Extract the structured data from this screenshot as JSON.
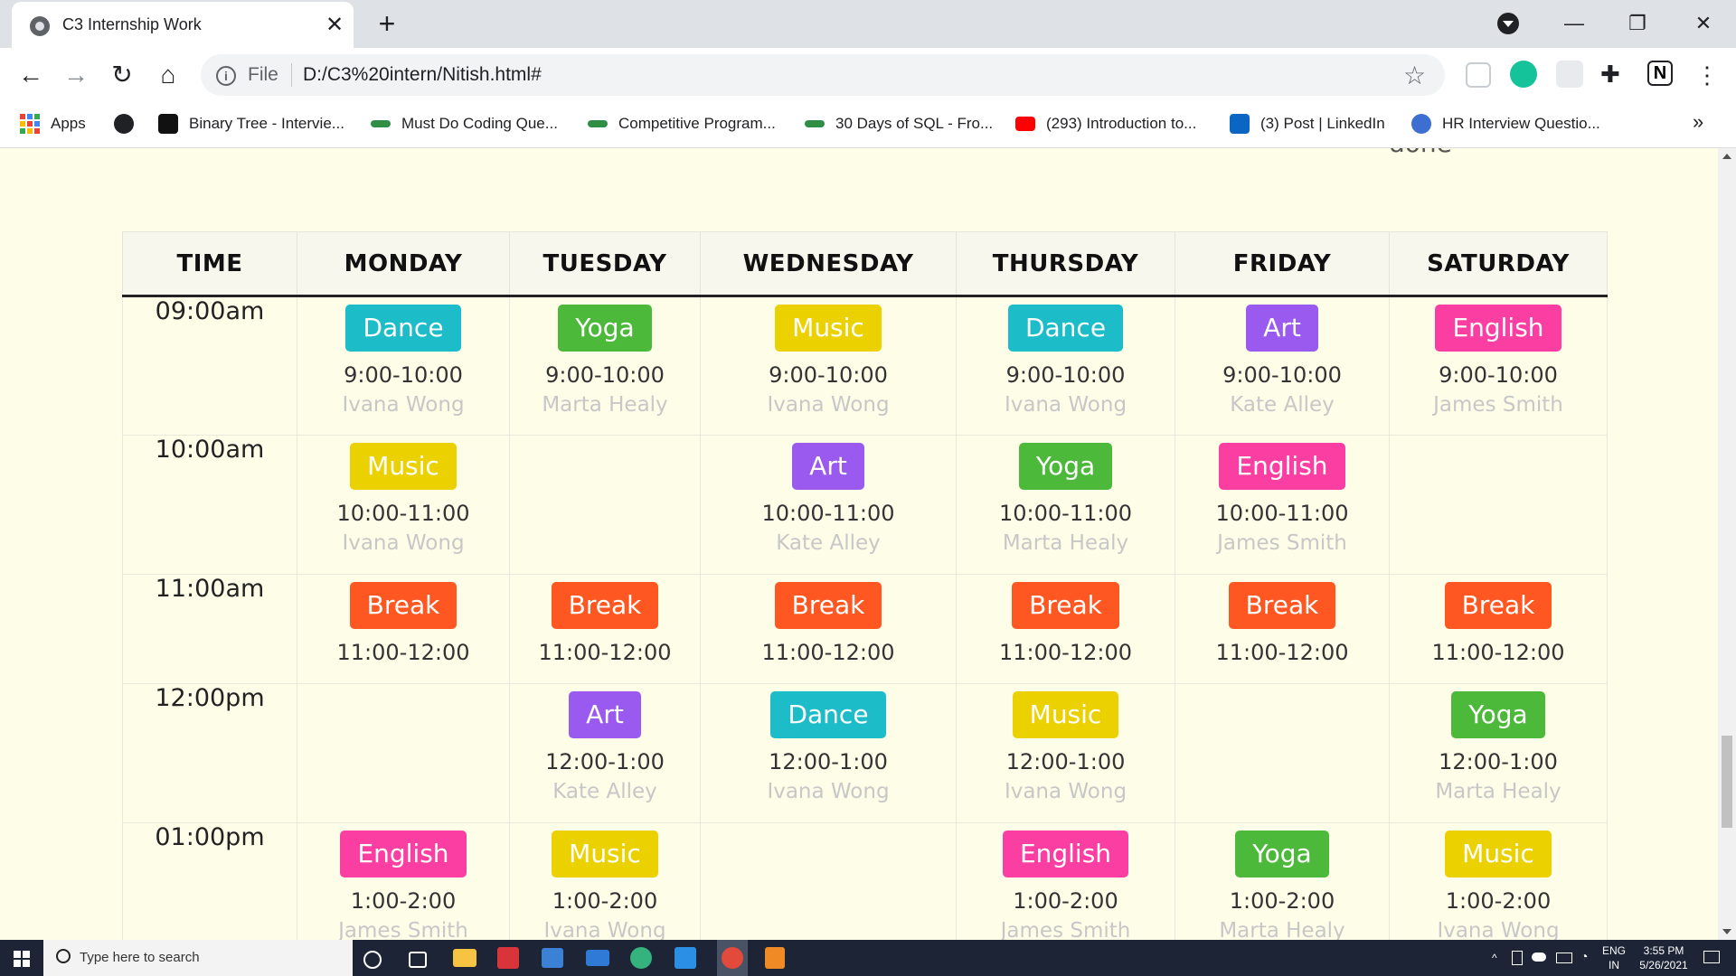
{
  "browser": {
    "tab_title": "C3 Internship Work",
    "tab_close": "✕",
    "new_tab": "+",
    "url_scheme": "File",
    "url": "D:/C3%20intern/Nitish.html#",
    "win_minimize": "—",
    "win_restore": "❐",
    "win_close": "✕"
  },
  "bookmarks": [
    {
      "label": "Apps"
    },
    {
      "label": ""
    },
    {
      "label": "Binary Tree - Intervie..."
    },
    {
      "label": "Must Do Coding Que..."
    },
    {
      "label": "Competitive Program..."
    },
    {
      "label": "30 Days of SQL - Fro..."
    },
    {
      "label": "(293) Introduction to..."
    },
    {
      "label": "(3) Post | LinkedIn"
    },
    {
      "label": "HR Interview Questio..."
    }
  ],
  "bookmarks_more": "»",
  "page": {
    "partial_text": "done",
    "headers": [
      "TIME",
      "MONDAY",
      "TUESDAY",
      "WEDNESDAY",
      "THURSDAY",
      "FRIDAY",
      "SATURDAY"
    ],
    "rows": [
      {
        "time": "09:00am",
        "cells": [
          {
            "subject": "Dance",
            "color": "#1cbcc8",
            "slot": "9:00-10:00",
            "teacher": "Ivana Wong"
          },
          {
            "subject": "Yoga",
            "color": "#4cb93a",
            "slot": "9:00-10:00",
            "teacher": "Marta Healy"
          },
          {
            "subject": "Music",
            "color": "#ecd100",
            "slot": "9:00-10:00",
            "teacher": "Ivana Wong"
          },
          {
            "subject": "Dance",
            "color": "#1cbcc8",
            "slot": "9:00-10:00",
            "teacher": "Ivana Wong"
          },
          {
            "subject": "Art",
            "color": "#9a59ef",
            "slot": "9:00-10:00",
            "teacher": "Kate Alley"
          },
          {
            "subject": "English",
            "color": "#fb3ea2",
            "slot": "9:00-10:00",
            "teacher": "James Smith"
          }
        ]
      },
      {
        "time": "10:00am",
        "cells": [
          {
            "subject": "Music",
            "color": "#ecd100",
            "slot": "10:00-11:00",
            "teacher": "Ivana Wong"
          },
          null,
          {
            "subject": "Art",
            "color": "#9a59ef",
            "slot": "10:00-11:00",
            "teacher": "Kate Alley"
          },
          {
            "subject": "Yoga",
            "color": "#4cb93a",
            "slot": "10:00-11:00",
            "teacher": "Marta Healy"
          },
          {
            "subject": "English",
            "color": "#fb3ea2",
            "slot": "10:00-11:00",
            "teacher": "James Smith"
          },
          null
        ]
      },
      {
        "time": "11:00am",
        "cells": [
          {
            "subject": "Break",
            "color": "#fe5722",
            "slot": "11:00-12:00",
            "teacher": ""
          },
          {
            "subject": "Break",
            "color": "#fe5722",
            "slot": "11:00-12:00",
            "teacher": ""
          },
          {
            "subject": "Break",
            "color": "#fe5722",
            "slot": "11:00-12:00",
            "teacher": ""
          },
          {
            "subject": "Break",
            "color": "#fe5722",
            "slot": "11:00-12:00",
            "teacher": ""
          },
          {
            "subject": "Break",
            "color": "#fe5722",
            "slot": "11:00-12:00",
            "teacher": ""
          },
          {
            "subject": "Break",
            "color": "#fe5722",
            "slot": "11:00-12:00",
            "teacher": ""
          }
        ]
      },
      {
        "time": "12:00pm",
        "cells": [
          null,
          {
            "subject": "Art",
            "color": "#9a59ef",
            "slot": "12:00-1:00",
            "teacher": "Kate Alley"
          },
          {
            "subject": "Dance",
            "color": "#1cbcc8",
            "slot": "12:00-1:00",
            "teacher": "Ivana Wong"
          },
          {
            "subject": "Music",
            "color": "#ecd100",
            "slot": "12:00-1:00",
            "teacher": "Ivana Wong"
          },
          null,
          {
            "subject": "Yoga",
            "color": "#4cb93a",
            "slot": "12:00-1:00",
            "teacher": "Marta Healy"
          }
        ]
      },
      {
        "time": "01:00pm",
        "cells": [
          {
            "subject": "English",
            "color": "#fb3ea2",
            "slot": "1:00-2:00",
            "teacher": "James Smith"
          },
          {
            "subject": "Music",
            "color": "#ecd100",
            "slot": "1:00-2:00",
            "teacher": "Ivana Wong"
          },
          null,
          {
            "subject": "English",
            "color": "#fb3ea2",
            "slot": "1:00-2:00",
            "teacher": "James Smith"
          },
          {
            "subject": "Yoga",
            "color": "#4cb93a",
            "slot": "1:00-2:00",
            "teacher": "Marta Healy"
          },
          {
            "subject": "Music",
            "color": "#ecd100",
            "slot": "1:00-2:00",
            "teacher": "Ivana Wong"
          }
        ]
      }
    ]
  },
  "taskbar": {
    "search_placeholder": "Type here to search",
    "lang_line1": "ENG",
    "lang_line2": "IN",
    "time": "3:55 PM",
    "date": "5/26/2021"
  }
}
